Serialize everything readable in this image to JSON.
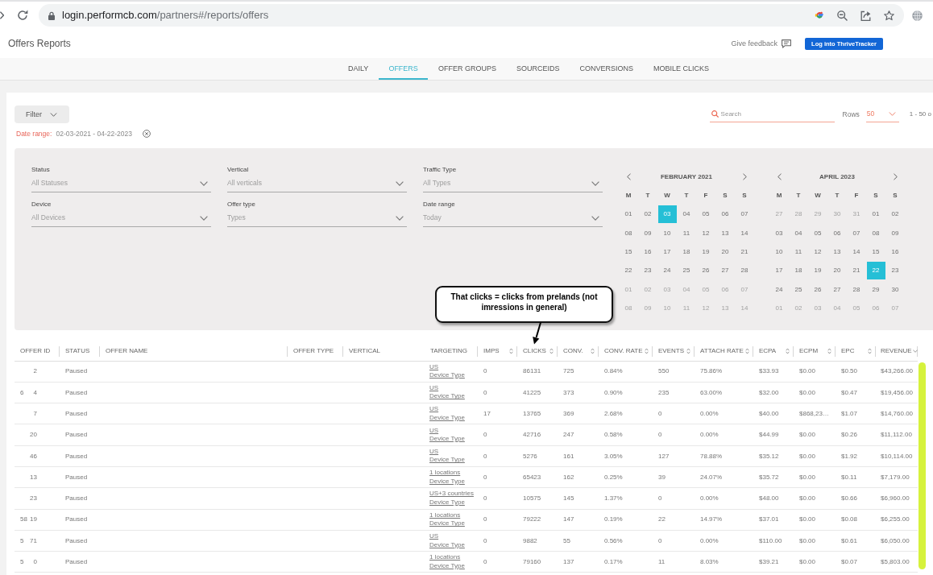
{
  "browser": {
    "url_host": "login.performcb.com",
    "url_path": "/partners#/reports/offers"
  },
  "header": {
    "title": "Offers Reports",
    "feedback_link": "Give feedback",
    "login_button": "Log into ThriveTracker"
  },
  "tabs": [
    {
      "label": "DAILY",
      "selected": false
    },
    {
      "label": "OFFERS",
      "selected": true
    },
    {
      "label": "OFFER GROUPS",
      "selected": false
    },
    {
      "label": "SOURCEIDS",
      "selected": false
    },
    {
      "label": "CONVERSIONS",
      "selected": false
    },
    {
      "label": "MOBILE CLICKS",
      "selected": false
    }
  ],
  "toolbar": {
    "filter_button": "Filter",
    "search": {
      "placeholder": "Search"
    },
    "rows_label": "Rows",
    "rows_value": "50",
    "pagination": "1 - 50 o"
  },
  "applied_filter": {
    "label": "Date range:",
    "value": "02-03-2021 - 04-22-2023"
  },
  "filters": [
    {
      "label": "Status",
      "value": "All Statuses"
    },
    {
      "label": "Vertical",
      "value": "All verticals"
    },
    {
      "label": "Traffic Type",
      "value": "All Types"
    },
    {
      "label": "Device",
      "value": "All Devices"
    },
    {
      "label": "Offer type",
      "value": "Types"
    },
    {
      "label": "Date range",
      "value": "Today"
    }
  ],
  "calendars": [
    {
      "month": "FEBRUARY 2021",
      "weekdays": [
        "M",
        "T",
        "W",
        "T",
        "F",
        "S",
        "S"
      ],
      "weeks": [
        [
          {
            "day": "01",
            "outside_month": false,
            "selected": false
          },
          {
            "day": "02",
            "outside_month": false,
            "selected": false
          },
          {
            "day": "03",
            "outside_month": false,
            "selected": true
          },
          {
            "day": "04",
            "outside_month": false,
            "selected": false
          },
          {
            "day": "05",
            "outside_month": false,
            "selected": false
          },
          {
            "day": "06",
            "outside_month": false,
            "selected": false
          },
          {
            "day": "07",
            "outside_month": false,
            "selected": false
          }
        ],
        [
          {
            "day": "08",
            "outside_month": false,
            "selected": false
          },
          {
            "day": "09",
            "outside_month": false,
            "selected": false
          },
          {
            "day": "10",
            "outside_month": false,
            "selected": false
          },
          {
            "day": "11",
            "outside_month": false,
            "selected": false
          },
          {
            "day": "12",
            "outside_month": false,
            "selected": false
          },
          {
            "day": "13",
            "outside_month": false,
            "selected": false
          },
          {
            "day": "14",
            "outside_month": false,
            "selected": false
          }
        ],
        [
          {
            "day": "15",
            "outside_month": false,
            "selected": false
          },
          {
            "day": "16",
            "outside_month": false,
            "selected": false
          },
          {
            "day": "17",
            "outside_month": false,
            "selected": false
          },
          {
            "day": "18",
            "outside_month": false,
            "selected": false
          },
          {
            "day": "19",
            "outside_month": false,
            "selected": false
          },
          {
            "day": "20",
            "outside_month": false,
            "selected": false
          },
          {
            "day": "21",
            "outside_month": false,
            "selected": false
          }
        ],
        [
          {
            "day": "22",
            "outside_month": false,
            "selected": false
          },
          {
            "day": "23",
            "outside_month": false,
            "selected": false
          },
          {
            "day": "24",
            "outside_month": false,
            "selected": false
          },
          {
            "day": "25",
            "outside_month": false,
            "selected": false
          },
          {
            "day": "26",
            "outside_month": false,
            "selected": false
          },
          {
            "day": "27",
            "outside_month": false,
            "selected": false
          },
          {
            "day": "28",
            "outside_month": false,
            "selected": false
          }
        ],
        [
          {
            "day": "01",
            "outside_month": true,
            "selected": false
          },
          {
            "day": "02",
            "outside_month": true,
            "selected": false
          },
          {
            "day": "03",
            "outside_month": true,
            "selected": false
          },
          {
            "day": "04",
            "outside_month": true,
            "selected": false
          },
          {
            "day": "05",
            "outside_month": true,
            "selected": false
          },
          {
            "day": "06",
            "outside_month": true,
            "selected": false
          },
          {
            "day": "07",
            "outside_month": true,
            "selected": false
          }
        ],
        [
          {
            "day": "08",
            "outside_month": true,
            "selected": false
          },
          {
            "day": "09",
            "outside_month": true,
            "selected": false
          },
          {
            "day": "10",
            "outside_month": true,
            "selected": false
          },
          {
            "day": "11",
            "outside_month": true,
            "selected": false
          },
          {
            "day": "12",
            "outside_month": true,
            "selected": false
          },
          {
            "day": "13",
            "outside_month": true,
            "selected": false
          },
          {
            "day": "14",
            "outside_month": true,
            "selected": false
          }
        ]
      ]
    },
    {
      "month": "APRIL 2023",
      "weekdays": [
        "M",
        "T",
        "W",
        "T",
        "F",
        "S",
        "S"
      ],
      "weeks": [
        [
          {
            "day": "27",
            "outside_month": true,
            "selected": false
          },
          {
            "day": "28",
            "outside_month": true,
            "selected": false
          },
          {
            "day": "29",
            "outside_month": true,
            "selected": false
          },
          {
            "day": "30",
            "outside_month": true,
            "selected": false
          },
          {
            "day": "31",
            "outside_month": true,
            "selected": false
          },
          {
            "day": "01",
            "outside_month": false,
            "selected": false
          },
          {
            "day": "02",
            "outside_month": false,
            "selected": false
          }
        ],
        [
          {
            "day": "03",
            "outside_month": false,
            "selected": false
          },
          {
            "day": "04",
            "outside_month": false,
            "selected": false
          },
          {
            "day": "05",
            "outside_month": false,
            "selected": false
          },
          {
            "day": "06",
            "outside_month": false,
            "selected": false
          },
          {
            "day": "07",
            "outside_month": false,
            "selected": false
          },
          {
            "day": "08",
            "outside_month": false,
            "selected": false
          },
          {
            "day": "09",
            "outside_month": false,
            "selected": false
          }
        ],
        [
          {
            "day": "10",
            "outside_month": false,
            "selected": false
          },
          {
            "day": "11",
            "outside_month": false,
            "selected": false
          },
          {
            "day": "12",
            "outside_month": false,
            "selected": false
          },
          {
            "day": "13",
            "outside_month": false,
            "selected": false
          },
          {
            "day": "14",
            "outside_month": false,
            "selected": false
          },
          {
            "day": "15",
            "outside_month": false,
            "selected": false
          },
          {
            "day": "16",
            "outside_month": false,
            "selected": false
          }
        ],
        [
          {
            "day": "17",
            "outside_month": false,
            "selected": false
          },
          {
            "day": "18",
            "outside_month": false,
            "selected": false
          },
          {
            "day": "19",
            "outside_month": false,
            "selected": false
          },
          {
            "day": "20",
            "outside_month": false,
            "selected": false
          },
          {
            "day": "21",
            "outside_month": false,
            "selected": false
          },
          {
            "day": "22",
            "outside_month": false,
            "selected": true
          },
          {
            "day": "23",
            "outside_month": false,
            "selected": false
          }
        ],
        [
          {
            "day": "24",
            "outside_month": false,
            "selected": false
          },
          {
            "day": "25",
            "outside_month": false,
            "selected": false
          },
          {
            "day": "26",
            "outside_month": false,
            "selected": false
          },
          {
            "day": "27",
            "outside_month": false,
            "selected": false
          },
          {
            "day": "28",
            "outside_month": false,
            "selected": false
          },
          {
            "day": "29",
            "outside_month": false,
            "selected": false
          },
          {
            "day": "30",
            "outside_month": false,
            "selected": false
          }
        ],
        [
          {
            "day": "01",
            "outside_month": true,
            "selected": false
          },
          {
            "day": "02",
            "outside_month": true,
            "selected": false
          },
          {
            "day": "03",
            "outside_month": true,
            "selected": false
          },
          {
            "day": "04",
            "outside_month": true,
            "selected": false
          },
          {
            "day": "05",
            "outside_month": true,
            "selected": false
          },
          {
            "day": "06",
            "outside_month": true,
            "selected": false
          },
          {
            "day": "07",
            "outside_month": true,
            "selected": false
          }
        ]
      ]
    }
  ],
  "annotation": {
    "text": "That clicks = clicks from prelands (not imressions in general)"
  },
  "table": {
    "columns": [
      {
        "label": "OFFER ID",
        "kind": "id",
        "sortable": false,
        "sorted": false
      },
      {
        "label": "STATUS",
        "kind": "status",
        "sortable": false,
        "sorted": false
      },
      {
        "label": "OFFER NAME",
        "kind": "blank",
        "sortable": false,
        "sorted": false
      },
      {
        "label": "OFFER TYPE",
        "kind": "blank",
        "sortable": false,
        "sorted": false
      },
      {
        "label": "VERTICAL",
        "kind": "blank",
        "sortable": false,
        "sorted": false
      },
      {
        "label": "TARGETING",
        "kind": "targeting",
        "sortable": false,
        "sorted": false
      },
      {
        "label": "IMPS",
        "kind": "metric",
        "sortable": true,
        "sorted": false
      },
      {
        "label": "CLICKS",
        "kind": "metric",
        "sortable": true,
        "sorted": false
      },
      {
        "label": "CONV.",
        "kind": "metric",
        "sortable": true,
        "sorted": false
      },
      {
        "label": "CONV. RATE",
        "kind": "metric",
        "sortable": true,
        "sorted": false
      },
      {
        "label": "EVENTS",
        "kind": "metric",
        "sortable": true,
        "sorted": false
      },
      {
        "label": "ATTACH RATE",
        "kind": "metric",
        "sortable": true,
        "sorted": false
      },
      {
        "label": "ECPA",
        "kind": "metric",
        "sortable": true,
        "sorted": false
      },
      {
        "label": "ECPM",
        "kind": "metric",
        "sortable": true,
        "sorted": false
      },
      {
        "label": "EPC",
        "kind": "metric",
        "sortable": true,
        "sorted": false
      },
      {
        "label": "REVENUE",
        "kind": "metric",
        "sortable": true,
        "sorted": true
      }
    ],
    "rows": [
      {
        "offer_id": {
          "end": "2"
        },
        "status": "Paused",
        "targeting": [
          "US",
          "Device Type"
        ],
        "metrics": [
          "0",
          "86131",
          "725",
          "0.84%",
          "550",
          "75.86%",
          "$33.93",
          "$0.00",
          "$0.50",
          "$43,266.00"
        ]
      },
      {
        "offer_id": {
          "start": "6",
          "end": "4"
        },
        "status": "Paused",
        "targeting": [
          "US",
          "Device Type"
        ],
        "metrics": [
          "0",
          "41225",
          "373",
          "0.90%",
          "235",
          "63.00%",
          "$32.00",
          "$0.00",
          "$0.47",
          "$19,456.00"
        ]
      },
      {
        "offer_id": {
          "end": "7"
        },
        "status": "Paused",
        "targeting": [
          "US",
          "Device Type"
        ],
        "metrics": [
          "17",
          "13765",
          "369",
          "2.68%",
          "0",
          "0.00%",
          "$40.00",
          "$868,23…",
          "$1.07",
          "$14,760.00"
        ]
      },
      {
        "offer_id": {
          "end": "20"
        },
        "status": "Paused",
        "targeting": [
          "US",
          "Device Type"
        ],
        "metrics": [
          "0",
          "42716",
          "247",
          "0.58%",
          "0",
          "0.00%",
          "$44.99",
          "$0.00",
          "$0.26",
          "$11,112.00"
        ]
      },
      {
        "offer_id": {
          "end": "46"
        },
        "status": "Paused",
        "targeting": [
          "US",
          "Device Type"
        ],
        "metrics": [
          "0",
          "5276",
          "161",
          "3.05%",
          "127",
          "78.88%",
          "$35.12",
          "$0.00",
          "$1.92",
          "$10,114.00"
        ]
      },
      {
        "offer_id": {
          "end": "13"
        },
        "status": "Paused",
        "targeting": [
          "1 locations",
          "Device Type"
        ],
        "metrics": [
          "0",
          "65423",
          "162",
          "0.25%",
          "39",
          "24.07%",
          "$35.72",
          "$0.00",
          "$0.11",
          "$7,179.00"
        ]
      },
      {
        "offer_id": {
          "end": "23"
        },
        "status": "Paused",
        "targeting": [
          "US+3 countries",
          "Device Type"
        ],
        "metrics": [
          "0",
          "10575",
          "145",
          "1.37%",
          "0",
          "0.00%",
          "$48.00",
          "$0.00",
          "$0.66",
          "$6,960.00"
        ]
      },
      {
        "offer_id": {
          "start": "58",
          "end": "19"
        },
        "status": "Paused",
        "targeting": [
          "1 locations",
          "Device Type"
        ],
        "metrics": [
          "0",
          "79222",
          "147",
          "0.19%",
          "22",
          "14.97%",
          "$37.01",
          "$0.00",
          "$0.08",
          "$6,255.00"
        ]
      },
      {
        "offer_id": {
          "start": "5",
          "end": "71"
        },
        "status": "Paused",
        "targeting": [
          "US",
          "Device Type"
        ],
        "metrics": [
          "0",
          "9882",
          "55",
          "0.56%",
          "0",
          "0.00%",
          "$110.00",
          "$0.00",
          "$0.61",
          "$6,050.00"
        ]
      },
      {
        "offer_id": {
          "start": "5",
          "end": "0"
        },
        "status": "Paused",
        "targeting": [
          "1 locations",
          "Device Type"
        ],
        "metrics": [
          "0",
          "79160",
          "137",
          "0.17%",
          "11",
          "8.03%",
          "$39.21",
          "$0.00",
          "$0.07",
          "$5,803.00"
        ]
      }
    ]
  }
}
